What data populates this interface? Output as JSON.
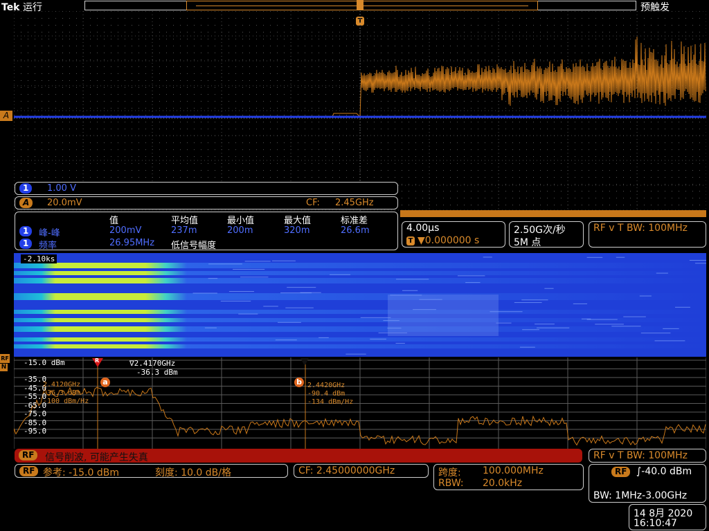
{
  "top": {
    "brand": "Tek",
    "mode": "运行",
    "trigger_state": "预触发",
    "trigger_marker": "T"
  },
  "channels": {
    "ch1": {
      "label": "1",
      "scale": "1.00 V"
    },
    "math": {
      "label": "A",
      "scale": "20.0mV",
      "cf_label": "CF:",
      "cf_value": "2.45GHz"
    },
    "marker_a": "A",
    "marker_rf": "RF",
    "marker_n": "N"
  },
  "measurements": {
    "headers": [
      "值",
      "平均值",
      "最小值",
      "最大值",
      "标准差"
    ],
    "rows": [
      {
        "ch": "1",
        "name": "峰-峰",
        "values": [
          "200mV",
          "237m",
          "200m",
          "320m",
          "26.6m"
        ]
      },
      {
        "ch": "1",
        "name": "频率",
        "values": [
          "26.95MHz"
        ],
        "note": "低信号幅度"
      }
    ]
  },
  "timebase": {
    "scale": "4.00µs",
    "trigger_pos": "▼0.000000 s",
    "sample_rate": "2.50G次/秒",
    "record": "5M 点",
    "rf_label": "RF v T BW: 100MHz"
  },
  "spectrogram": {
    "time_label": "-2.10ks"
  },
  "spectrum": {
    "ref_level": "-15.0 dBm",
    "y_ticks": [
      "-35.0",
      "-45.0",
      "-55.0",
      "-65.0",
      "-75.0",
      "-85.0",
      "-95.0"
    ],
    "marker_r": {
      "label": "R",
      "freq": "2.4120GHz",
      "level": "-36.3 dBm",
      "density": "-100 dBm/Hz"
    },
    "marker_ref2": {
      "freq": "∇2.4170GHz",
      "level": "-36.3 dBm"
    },
    "marker_b": {
      "label": "b",
      "freq": "2.4420GHz",
      "level": "-90.4 dBm",
      "density": "-134 dBm/Hz"
    },
    "marker_a_label": "a",
    "warning": "信号削波, 可能产生失真"
  },
  "bottom": {
    "rf_badge": "RF",
    "ref_label": "参考: -15.0 dBm",
    "scale_label": "刻度: 10.0 dB/格",
    "cf": "CF:  2.45000000GHz",
    "span_label": "跨度:",
    "span_value": "100.000MHz",
    "rbw_label": "RBW:",
    "rbw_value": "20.0kHz",
    "rf_vt": "RF v T BW: 100MHz",
    "trigger_level": "∫-40.0 dBm",
    "bw": "BW: 1MHz-3.00GHz",
    "date": "14 8月  2020",
    "time": "16:10:47"
  }
}
